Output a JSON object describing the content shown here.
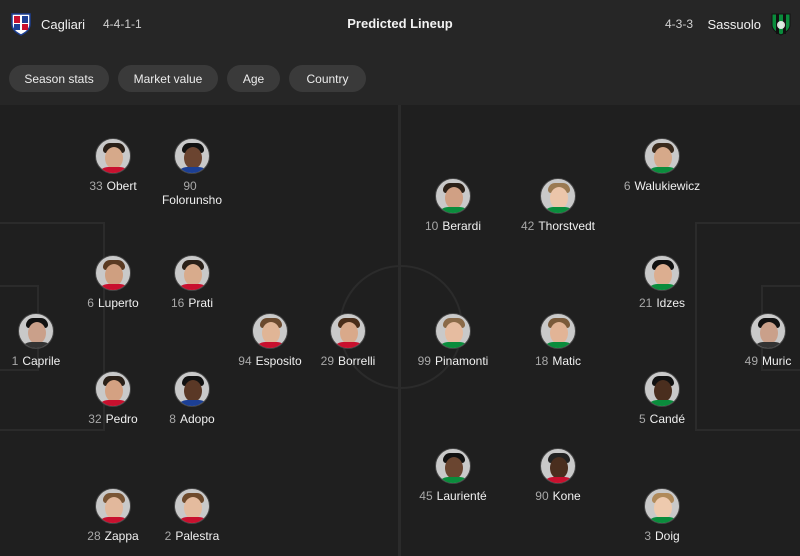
{
  "header": {
    "title": "Predicted Lineup",
    "home_team": "Cagliari",
    "home_formation": "4-4-1-1",
    "away_team": "Sassuolo",
    "away_formation": "4-3-3"
  },
  "filters": [
    "Season stats",
    "Market value",
    "Age",
    "Country"
  ],
  "colors": {
    "cagliari_red": "#c8102e",
    "cagliari_blue": "#1c3f94",
    "sassuolo_green": "#0a8c3c",
    "sassuolo_black": "#111111"
  },
  "home_players": [
    {
      "num": "33",
      "name": "Obert"
    },
    {
      "num": "90",
      "name": "Folorunsho"
    },
    {
      "num": "6",
      "name": "Luperto"
    },
    {
      "num": "16",
      "name": "Prati"
    },
    {
      "num": "1",
      "name": "Caprile"
    },
    {
      "num": "94",
      "name": "Esposito"
    },
    {
      "num": "29",
      "name": "Borrelli"
    },
    {
      "num": "32",
      "name": "Pedro"
    },
    {
      "num": "8",
      "name": "Adopo"
    },
    {
      "num": "28",
      "name": "Zappa"
    },
    {
      "num": "2",
      "name": "Palestra"
    }
  ],
  "away_players": [
    {
      "num": "6",
      "name": "Walukiewicz"
    },
    {
      "num": "10",
      "name": "Berardi"
    },
    {
      "num": "42",
      "name": "Thorstvedt"
    },
    {
      "num": "21",
      "name": "Idzes"
    },
    {
      "num": "99",
      "name": "Pinamonti"
    },
    {
      "num": "18",
      "name": "Matic"
    },
    {
      "num": "49",
      "name": "Muric"
    },
    {
      "num": "5",
      "name": "Candé"
    },
    {
      "num": "45",
      "name": "Laurienté"
    },
    {
      "num": "90",
      "name": "Kone"
    },
    {
      "num": "3",
      "name": "Doig"
    }
  ]
}
